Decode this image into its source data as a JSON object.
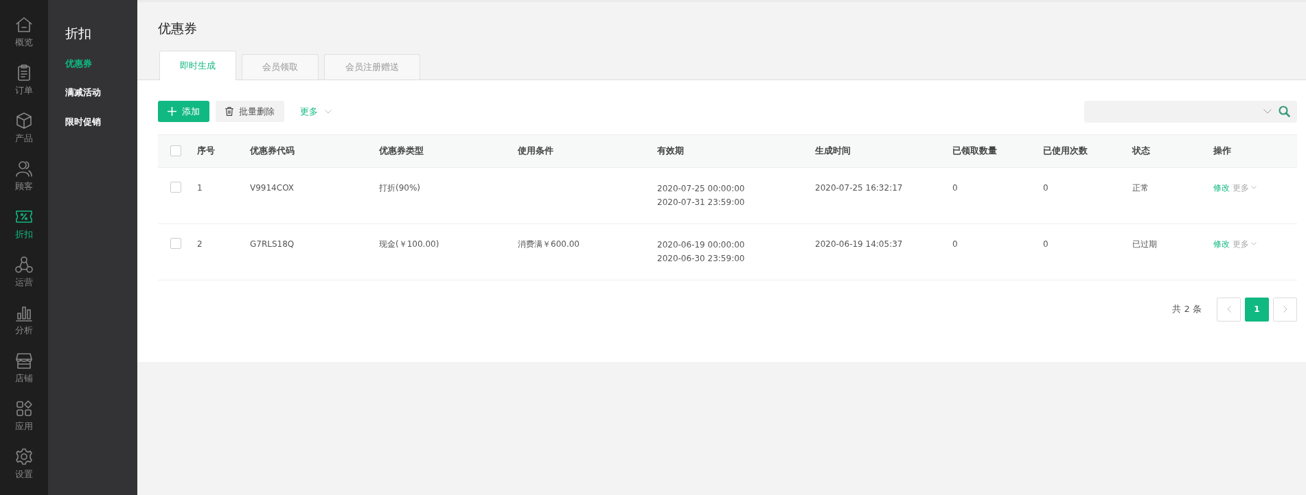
{
  "nav_rail": {
    "items": [
      {
        "label": "概览",
        "selected": false
      },
      {
        "label": "订单",
        "selected": false
      },
      {
        "label": "产品",
        "selected": false
      },
      {
        "label": "顾客",
        "selected": false
      },
      {
        "label": "折扣",
        "selected": true
      },
      {
        "label": "运营",
        "selected": false
      },
      {
        "label": "分析",
        "selected": false
      },
      {
        "label": "店铺",
        "selected": false
      },
      {
        "label": "应用",
        "selected": false
      },
      {
        "label": "设置",
        "selected": false
      }
    ]
  },
  "sidebar": {
    "title": "折扣",
    "items": [
      {
        "label": "优惠券",
        "selected": true
      },
      {
        "label": "满减活动",
        "selected": false
      },
      {
        "label": "限时促销",
        "selected": false
      }
    ]
  },
  "page_title": "优惠券",
  "tabs": [
    {
      "label": "即时生成",
      "selected": true
    },
    {
      "label": "会员领取",
      "selected": false
    },
    {
      "label": "会员注册赠送",
      "selected": false
    }
  ],
  "toolbar": {
    "add_button": "添加",
    "delete_button": "批量删除",
    "more_button": "更多"
  },
  "table": {
    "select_all_checked": false,
    "columns": [
      "序号",
      "优惠券代码",
      "优惠券类型",
      "使用条件",
      "有效期",
      "生成时间",
      "已领取数量",
      "已使用次数",
      "状态",
      "操作"
    ],
    "rows": [
      {
        "checked": false,
        "index": "1",
        "code": "V9914COX",
        "type": "打折(90%)",
        "condition": "",
        "validity": [
          "2020-07-25 00:00:00",
          "2020-07-31 23:59:00"
        ],
        "created": "2020-07-25 16:32:17",
        "claimed": "0",
        "used": "0",
        "status": "正常",
        "edit": "修改",
        "more": "更多"
      },
      {
        "checked": false,
        "index": "2",
        "code": "G7RLS18Q",
        "type": "现金(￥100.00)",
        "condition": "消费满￥600.00",
        "validity": [
          "2020-06-19 00:00:00",
          "2020-06-30 23:59:00"
        ],
        "created": "2020-06-19 14:05:37",
        "claimed": "0",
        "used": "0",
        "status": "已过期",
        "edit": "修改",
        "more": "更多"
      }
    ]
  },
  "pagination": {
    "total": "共 2 条",
    "pages": [
      {
        "label": "1",
        "selected": true
      }
    ]
  }
}
